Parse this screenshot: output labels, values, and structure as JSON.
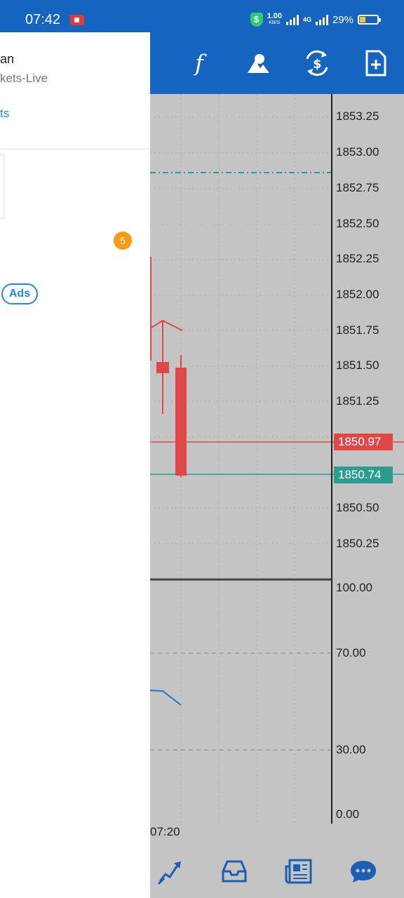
{
  "status_bar": {
    "time": "07:42",
    "net_speed_value": "1.00",
    "net_speed_unit": "KB/S",
    "network_type": "4G",
    "battery": "29%"
  },
  "toolbar": {
    "icons": [
      "function-icon",
      "objects-icon",
      "trade-icon",
      "new-order-icon"
    ]
  },
  "chart": {
    "price_ticks": [
      "1853.25",
      "1853.00",
      "1852.75",
      "1852.50",
      "1852.25",
      "1852.00",
      "1851.75",
      "1851.50",
      "1851.25",
      "1850.50",
      "1850.25"
    ],
    "bid_label": "1850.97",
    "ask_label": "1850.74",
    "indicator_ticks": [
      "100.00",
      "70.00",
      "30.00",
      "0.00"
    ],
    "time_label": "07:20",
    "colors": {
      "bid": "#e04848",
      "ask": "#2a9d8f",
      "grid": "#b3b3b3",
      "indicator": "#1e78d2"
    }
  },
  "drawer": {
    "account_name": "an",
    "server_name": "kets-Live",
    "link": "ts",
    "badge_count": "5",
    "ads_label": "Ads"
  },
  "bottom_nav": {
    "icons": [
      "trade-history-icon",
      "mailbox-icon",
      "news-icon",
      "chat-icon"
    ]
  }
}
